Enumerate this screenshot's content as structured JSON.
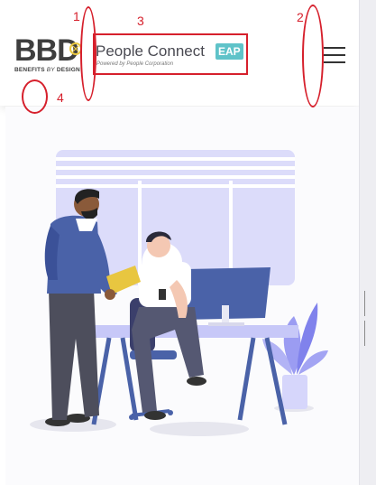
{
  "header": {
    "bbd_logo": {
      "letters": "BBD",
      "subtitle_prefix": "BENEFITS ",
      "subtitle_by": "BY",
      "subtitle_suffix": " DESIGN"
    },
    "people_connect_logo": {
      "name": "People Connect",
      "badge": "EAP",
      "powered_by": "Powered by People Corporation"
    },
    "menu_icon": "hamburger-menu-icon"
  },
  "annotations": [
    "1",
    "2",
    "3",
    "4"
  ],
  "colors": {
    "annotation_red": "#d6202c",
    "eap_teal": "#5fc3c9",
    "illustration_lavender": "#dcdcfa",
    "illustration_blue": "#4a62a8"
  }
}
